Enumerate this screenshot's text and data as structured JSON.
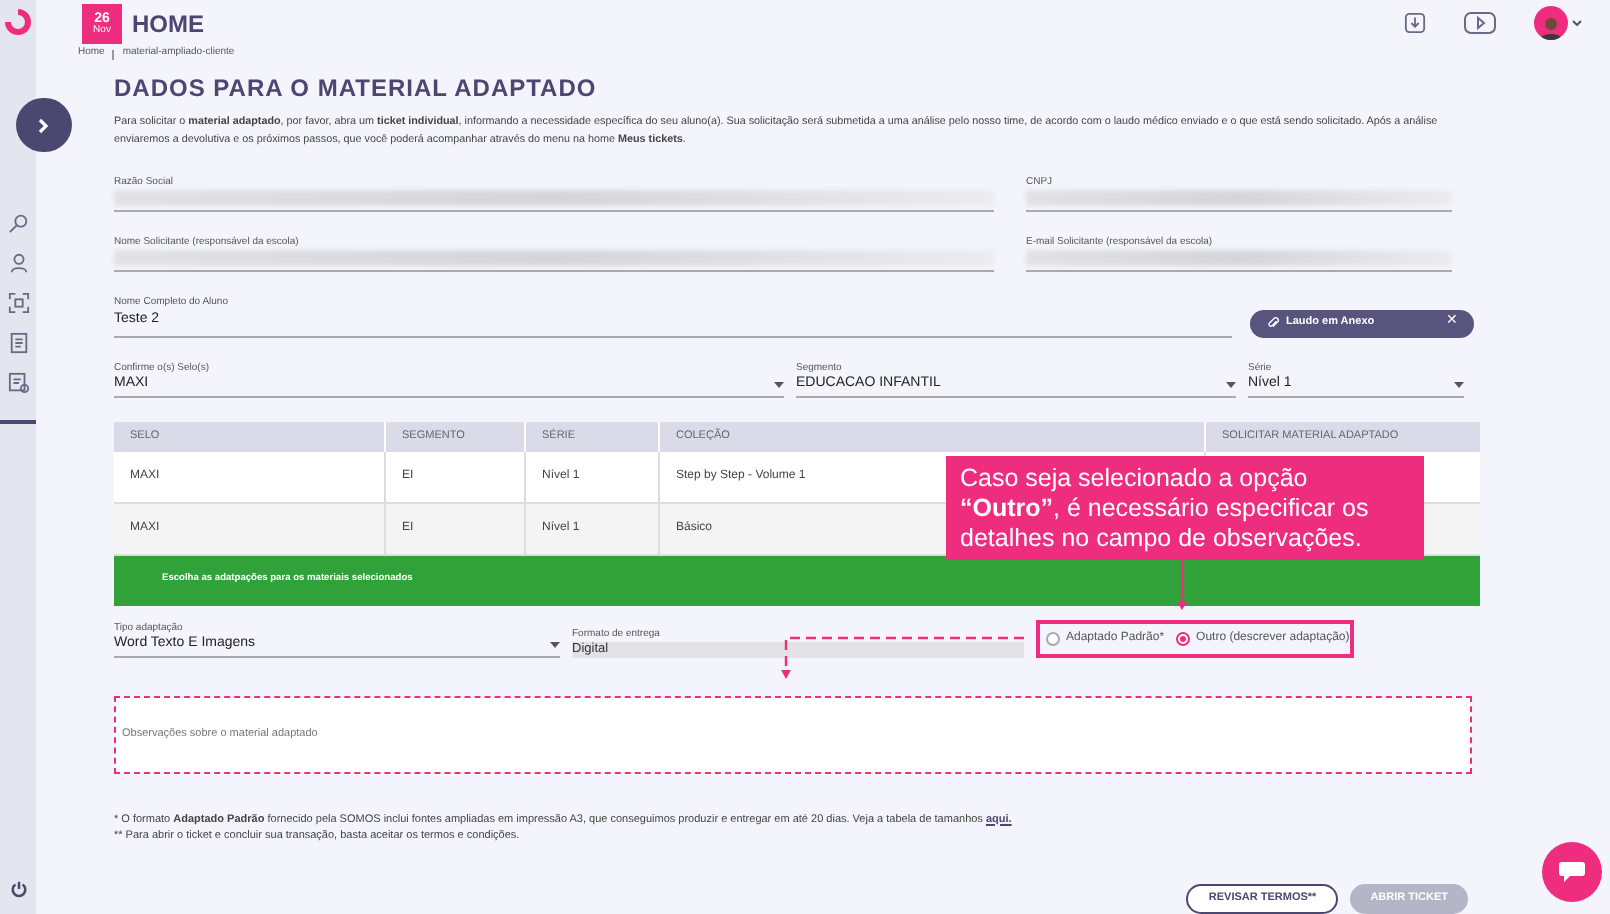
{
  "header": {
    "date_day": "26",
    "date_month": "Nov",
    "title": "HOME"
  },
  "breadcrumb": [
    "Home",
    "material-ampliado-cliente"
  ],
  "page_title": "DADOS PARA O MATERIAL ADAPTADO",
  "intro": "Para solicitar o **material adaptado**, por favor, abra um **ticket individual**, informando a necessidade específica do seu aluno(a). Sua solicitação será submetida a uma análise pelo nosso time, de acordo com o laudo médico enviado e o que está sendo solicitado. Após a análise enviaremos a devolutiva e os próximos passos, que você poderá acompanhar através do menu na home **Meus tickets**.",
  "fields_top": [
    {
      "label": "Razão Social"
    },
    {
      "label": "CNPJ"
    },
    {
      "label": "Nome Solicitante (responsável da escola)"
    },
    {
      "label": "E-mail Solicitante (responsável da escola)"
    }
  ],
  "student": {
    "label": "Nome Completo do Aluno",
    "value": "Teste 2"
  },
  "attachment": {
    "label": "Laudo em Anexo",
    "close": "✕"
  },
  "selects": [
    {
      "label": "Confirme o(s) Selo(s)",
      "value": "MAXI"
    },
    {
      "label": "Segmento",
      "value": "EDUCACAO INFANTIL"
    },
    {
      "label": "Série",
      "value": "Nível 1"
    }
  ],
  "table": {
    "columns": [
      "SELO",
      "SEGMENTO",
      "SÉRIE",
      "COLEÇÃO",
      "SOLICITAR MATERIAL ADAPTADO"
    ],
    "rows": [
      [
        "MAXI",
        "EI",
        "Nível 1",
        "Step by Step - Volume 1"
      ],
      [
        "MAXI",
        "EI",
        "Nível 1",
        "Básico"
      ]
    ],
    "banner": "Escolha as adatpações para os materiais selecionados"
  },
  "adaptation": {
    "type_label": "Tipo adaptação",
    "type_value": "Word Texto E Imagens",
    "format_label": "Formato de entrega",
    "format_value": "Digital",
    "radios": [
      {
        "label": "Adaptado Padrão*",
        "selected": false
      },
      {
        "label": "Outro (descrever adaptação)",
        "selected": true
      }
    ]
  },
  "notes": {
    "placeholder": "Observações sobre o material adaptado"
  },
  "callout": "Caso seja selecionado a opção **“Outro”**, é necessário especificar os detalhes no campo de observações.",
  "footnotes": {
    "line1": "* O formato **Adaptado Padrão** fornecido pela SOMOS inclui fontes ampliadas em impressão A3, que conseguimos produzir e entregar em até 20 dias. Veja a tabela de tamanhos",
    "link": "aqui.",
    "line2": "** Para abrir o ticket e concluir sua transação, basta aceitar os termos e condições."
  },
  "buttons": [
    {
      "label": "REVISAR TERMOS**",
      "disabled": false
    },
    {
      "label": "ABRIR TICKET",
      "disabled": true
    }
  ]
}
